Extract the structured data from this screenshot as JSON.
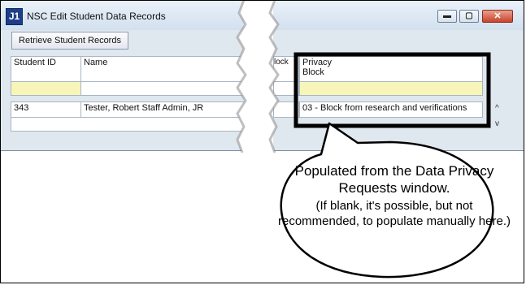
{
  "window": {
    "icon_text": "J1",
    "title": "NSC Edit Student Data Records"
  },
  "toolbar": {
    "retrieve_label": "Retrieve Student Records"
  },
  "columns": {
    "student_id": "Student ID",
    "name": "Name",
    "block_partial": "lock",
    "privacy_line1": "Privacy",
    "privacy_line2": "Block"
  },
  "rows": [
    {
      "student_id": "343",
      "name": "Tester, Robert Staff Admin, JR",
      "privacy_block": "03 - Block from research and verifications"
    }
  ],
  "callout": {
    "main": "Populated from the Data Privacy Requests window.",
    "sub": "(If blank, it's possible, but not recommended, to populate manually here.)"
  },
  "colors": {
    "highlight_border": "#000000",
    "filter_fill": "#f7f6b8",
    "title_icon": "#1e3f86"
  }
}
